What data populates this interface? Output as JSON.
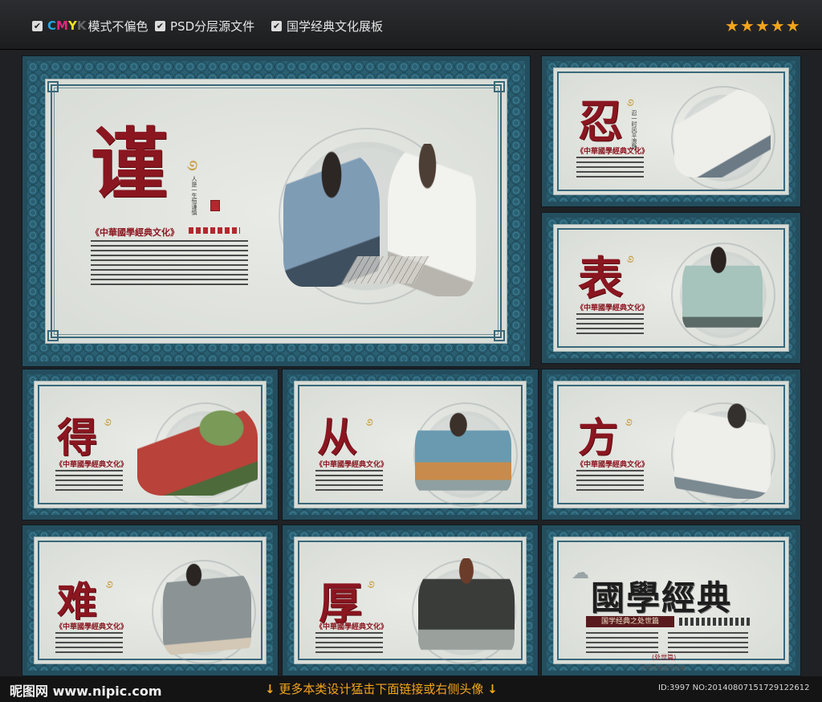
{
  "features": [
    {
      "cmy": [
        "C",
        "M",
        "Y"
      ],
      "label": "模式不偏色"
    },
    {
      "label": "PSD分层源文件"
    },
    {
      "label": "国学经典文化展板"
    }
  ],
  "rating": "★★★★★",
  "boards": {
    "main": {
      "char": "谨",
      "subtitle": "《中華國學經典文化》"
    },
    "ren": {
      "char": "忍",
      "subtitle": "《中華國學經典文化》"
    },
    "biao": {
      "char": "表",
      "subtitle": "《中華國學經典文化》"
    },
    "de": {
      "char": "得",
      "subtitle": "《中華國學經典文化》"
    },
    "cong": {
      "char": "从",
      "subtitle": "《中華國學經典文化》"
    },
    "fang": {
      "char": "方",
      "subtitle": "《中華國學經典文化》"
    },
    "nan": {
      "char": "难",
      "subtitle": "《中華國學經典文化》"
    },
    "hou": {
      "char": "厚",
      "subtitle": "《中華國學經典文化》"
    },
    "cover": {
      "title": "國學經典",
      "subtitle": "国学经典之处世篇",
      "tag": "(处世篇)",
      "foot": "中华传统国学经典"
    }
  },
  "footer": {
    "site": "昵图网 www.nipic.com",
    "promo": "更多本类设计猛击下面链接或右侧头像",
    "id": "ID:3997 NO:20140807151729122612"
  },
  "colors": {
    "accent": "#f4a51c",
    "board": "#2a5f72",
    "red": "#8a1620"
  }
}
